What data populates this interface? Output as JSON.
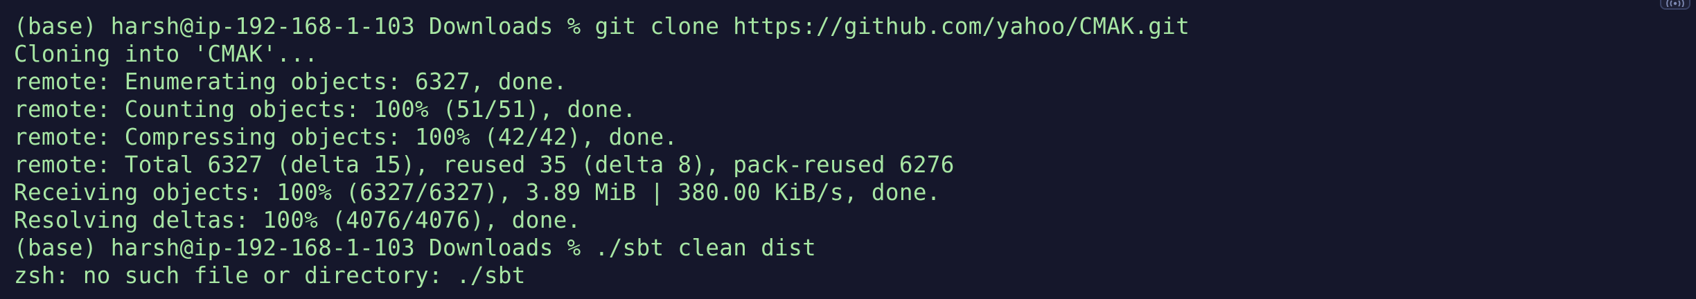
{
  "terminal": {
    "lines": [
      "(base) harsh@ip-192-168-1-103 Downloads % git clone https://github.com/yahoo/CMAK.git",
      "Cloning into 'CMAK'...",
      "remote: Enumerating objects: 6327, done.",
      "remote: Counting objects: 100% (51/51), done.",
      "remote: Compressing objects: 100% (42/42), done.",
      "remote: Total 6327 (delta 15), reused 35 (delta 8), pack-reused 6276",
      "Receiving objects: 100% (6327/6327), 3.89 MiB | 380.00 KiB/s, done.",
      "Resolving deltas: 100% (4076/4076), done.",
      "(base) harsh@ip-192-168-1-103 Downloads % ./sbt clean dist",
      "zsh: no such file or directory: ./sbt"
    ]
  },
  "colors": {
    "background": "#15172b",
    "text": "#a7e6a3",
    "icon_border": "#3a4366"
  },
  "icons": {
    "top_right": "broadcast-icon"
  }
}
